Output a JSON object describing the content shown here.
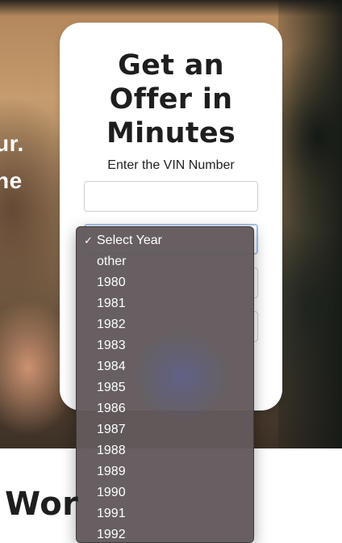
{
  "hero": {
    "line1": "ur.",
    "line2": "ne"
  },
  "form": {
    "title": [
      "Get an",
      "Offer in",
      "Minutes"
    ],
    "vin_label": "Enter the VIN Number",
    "vin_value": ""
  },
  "year_dropdown": {
    "selected": "Select Year",
    "options": [
      "Select Year",
      "other",
      "1980",
      "1981",
      "1982",
      "1983",
      "1984",
      "1985",
      "1986",
      "1987",
      "1988",
      "1989",
      "1990",
      "1991",
      "1992"
    ]
  },
  "section": {
    "heading": "Wor"
  }
}
